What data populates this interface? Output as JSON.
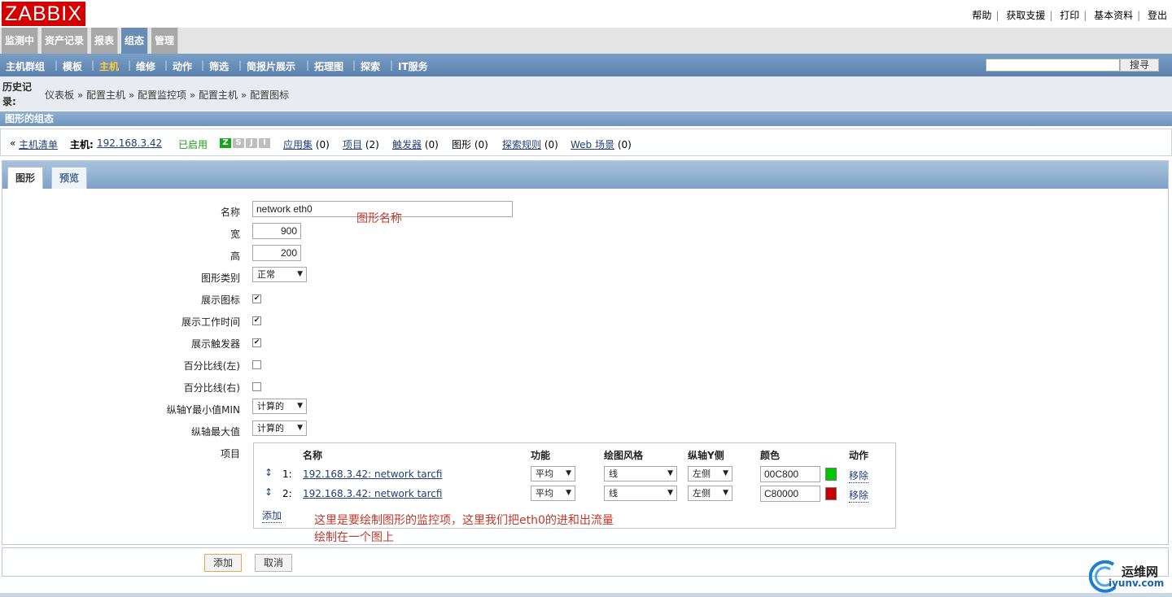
{
  "logo": "ZABBIX",
  "toplinks": [
    "帮助",
    "获取支援",
    "打印",
    "基本资料",
    "登出"
  ],
  "mainmenu": [
    {
      "label": "监测中",
      "active": false
    },
    {
      "label": "资产记录",
      "active": false
    },
    {
      "label": "报表",
      "active": false
    },
    {
      "label": "组态",
      "active": true
    },
    {
      "label": "管理",
      "active": false
    }
  ],
  "submenu": [
    {
      "label": "主机群组",
      "active": false
    },
    {
      "label": "模板",
      "active": false
    },
    {
      "label": "主机",
      "active": true
    },
    {
      "label": "维修",
      "active": false
    },
    {
      "label": "动作",
      "active": false
    },
    {
      "label": "筛选",
      "active": false
    },
    {
      "label": "简报片展示",
      "active": false
    },
    {
      "label": "拓理图",
      "active": false
    },
    {
      "label": "探索",
      "active": false
    },
    {
      "label": "IT服务",
      "active": false
    }
  ],
  "search": {
    "value": "",
    "button": "搜寻"
  },
  "history": {
    "label": "历史记录:",
    "crumbs": [
      "仪表板",
      "配置主机",
      "配置监控项",
      "配置主机",
      "配置图标"
    ],
    "separator": "»"
  },
  "section_title": "图形的组态",
  "hostbar": {
    "back_prefix": "«",
    "back_label": "主机清单",
    "host_label": "主机:",
    "host_value": "192.168.3.42",
    "status": "已启用",
    "status_icons": [
      {
        "glyph": "Z",
        "color": "#1aa31a"
      },
      {
        "glyph": "S",
        "color": "#bdbdbd"
      },
      {
        "glyph": "J",
        "color": "#bdbdbd"
      },
      {
        "glyph": "I",
        "color": "#bdbdbd"
      }
    ],
    "links": [
      {
        "label": "应用集",
        "count": "(0)"
      },
      {
        "label": "项目",
        "count": "(2)"
      },
      {
        "label": "触发器",
        "count": "(0)"
      },
      {
        "label": "图形",
        "count": "(0)"
      },
      {
        "label": "探索规则",
        "count": "(0)"
      },
      {
        "label": "Web 场景",
        "count": "(0)"
      }
    ]
  },
  "tabs": [
    {
      "label": "图形",
      "active": true
    },
    {
      "label": "预览",
      "active": false
    }
  ],
  "form": {
    "name_label": "名称",
    "name_value": "network eth0",
    "width_label": "宽",
    "width_value": "900",
    "height_label": "高",
    "height_value": "200",
    "graph_type_label": "图形类别",
    "graph_type_value": "正常",
    "show_legend_label": "展示图标",
    "show_worktime_label": "展示工作时间",
    "show_triggers_label": "展示触发器",
    "percentile_left_label": "百分比线(左)",
    "percentile_right_label": "百分比线(右)",
    "ymin_label": "纵轴Y最小值MIN",
    "ymin_value": "计算的",
    "ymax_label": "纵轴最大值",
    "ymax_value": "计算的",
    "items_label": "项目",
    "checks": {
      "show_legend": true,
      "show_worktime": true,
      "show_triggers": true,
      "percentile_left": false,
      "percentile_right": false
    }
  },
  "items_table": {
    "headers": [
      "名称",
      "功能",
      "绘图风格",
      "纵轴Y侧",
      "颜色",
      "动作"
    ],
    "rows": [
      {
        "index": "1:",
        "name": "192.168.3.42: network tarcfi",
        "function": "平均",
        "style": "线",
        "yaxis": "左侧",
        "color": "00C800",
        "color_hex": "#00c800",
        "action": "移除"
      },
      {
        "index": "2:",
        "name": "192.168.3.42: network tarcfi",
        "function": "平均",
        "style": "线",
        "yaxis": "左侧",
        "color": "C80000",
        "color_hex": "#c80000",
        "action": "移除"
      }
    ],
    "add_label": "添加"
  },
  "annotations": {
    "name_note": "图形名称",
    "items_note_line1": "这里是要绘制图形的监控项，这里我们把eth0的进和出流量",
    "items_note_line2": "绘制在一个图上"
  },
  "buttons": {
    "add": "添加",
    "cancel": "取消"
  },
  "watermark": {
    "text1": "运维网",
    "text2": "iyunv.com"
  }
}
